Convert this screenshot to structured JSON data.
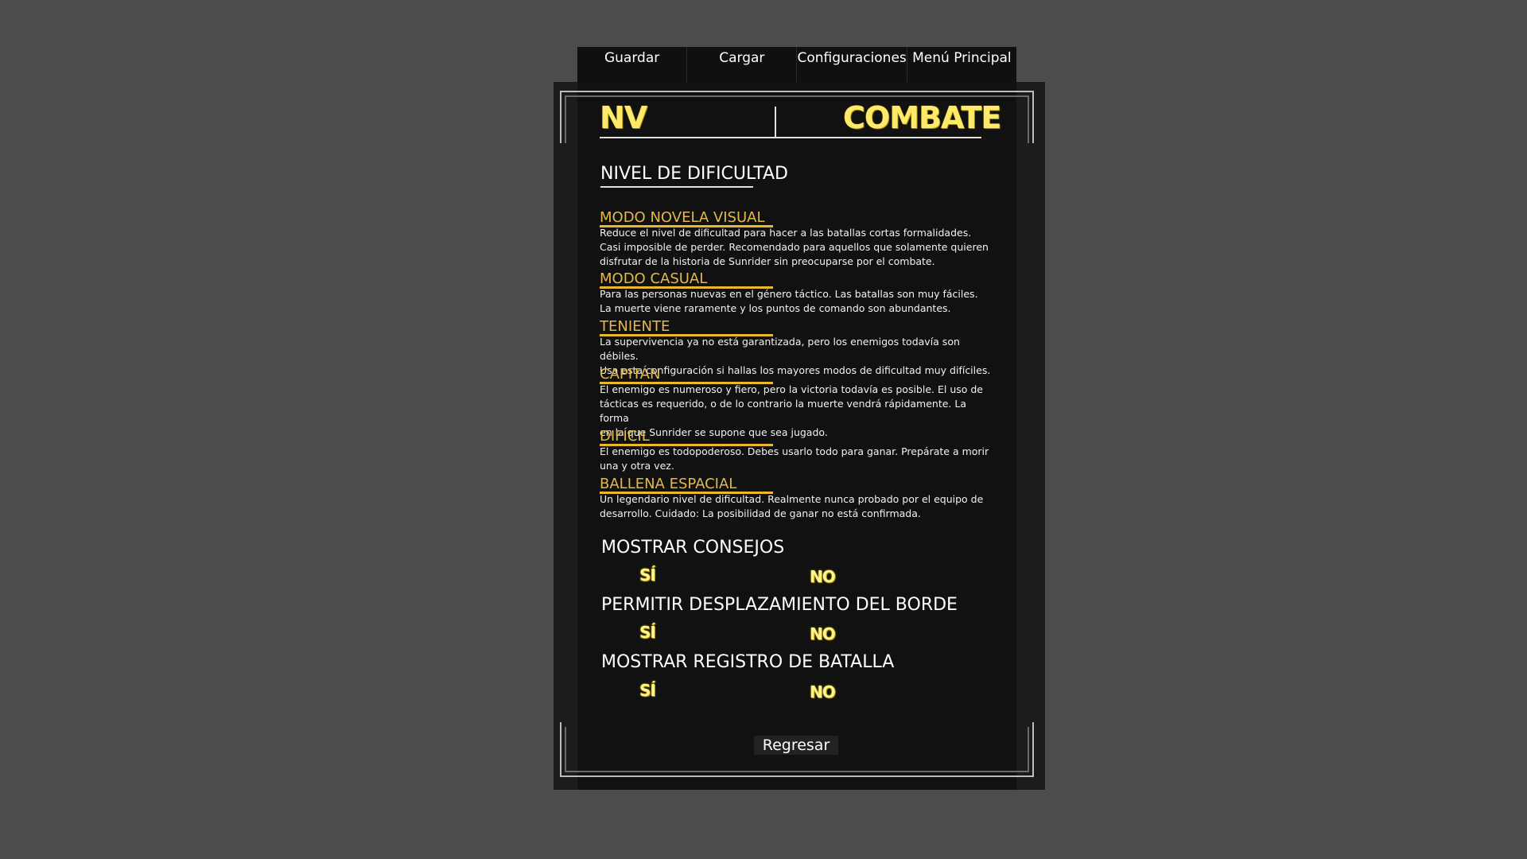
{
  "tabs": [
    {
      "label": "Guardar"
    },
    {
      "label": "Cargar"
    },
    {
      "label": "Configuraciones"
    },
    {
      "label": "Menú Principal"
    }
  ],
  "header": {
    "left_title": "NV",
    "right_title": "COMBATE"
  },
  "difficulty": {
    "heading": "NIVEL DE DIFICULTAD",
    "modes": [
      {
        "name": "MODO NOVELA VISUAL",
        "lines": [
          "Reduce el nivel de dificultad para hacer a las batallas cortas formalidades.",
          "Casi imposible de perder.  Recomendado para aquellos que solamente quieren",
          "disfrutar de la historia de Sunrider sin preocuparse por el combate."
        ]
      },
      {
        "name": "MODO CASUAL",
        "lines": [
          "Para las personas nuevas en el género táctico.  Las batallas son muy fáciles.",
          "La muerte viene raramente y los puntos de comando son abundantes."
        ]
      },
      {
        "name": "TENIENTE",
        "lines": [
          "La supervivencia ya no está garantizada, pero los enemigos todavía son débiles.",
          "Usa esta configuración si hallas los mayores modos de dificultad muy difíciles."
        ]
      },
      {
        "name": "CAPITÁN",
        "lines": [
          "El enemigo es numeroso y fiero, pero la victoria todavía es posible.  El uso de",
          "tácticas es requerido, o de lo contrario la muerte vendrá rápidamente.  La forma",
          "en la que Sunrider se supone que sea jugado."
        ]
      },
      {
        "name": "DIFÍCIL",
        "lines": [
          "El enemigo es todopoderoso.  Debes usarlo todo para ganar.  Prepárate a morir",
          "una y otra vez."
        ]
      },
      {
        "name": "BALLENA ESPACIAL",
        "lines": [
          "Un legendario nivel de dificultad.  Realmente nunca probado por el equipo de",
          "desarrollo.  Cuidado: La posibilidad de ganar no está confirmada."
        ]
      }
    ]
  },
  "options": [
    {
      "heading": "MOSTRAR CONSEJOS",
      "yes": "SÍ",
      "no": "NO"
    },
    {
      "heading": "PERMITIR DESPLAZAMIENTO DEL BORDE",
      "yes": "SÍ",
      "no": "NO"
    },
    {
      "heading": "MOSTRAR REGISTRO DE BATALLA",
      "yes": "SÍ",
      "no": "NO"
    }
  ],
  "back_label": "Regresar",
  "colors": {
    "background": "#4c4c4c",
    "panel": "#111111",
    "title_yellow": "#ffe96a",
    "mode_gold": "#e3b948",
    "underline_gold": "#e7b92b"
  }
}
